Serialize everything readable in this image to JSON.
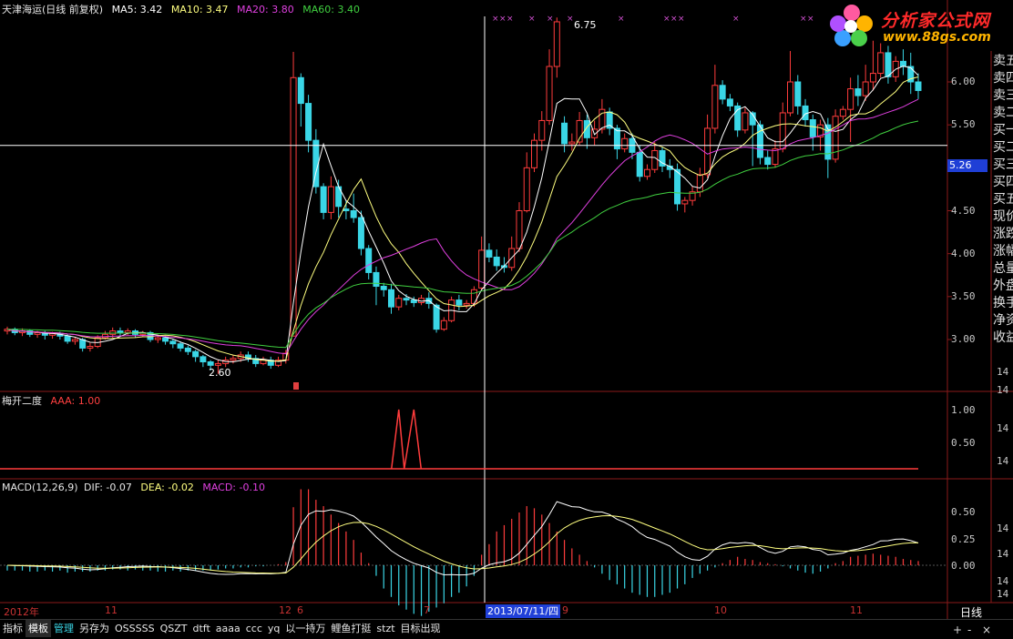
{
  "header_main": {
    "title": "天津海运(日线 前复权)",
    "ma5": "MA5: 3.42",
    "ma10": "MA10: 3.47",
    "ma20": "MA20: 3.80",
    "ma60": "MA60: 3.40"
  },
  "header_ind": {
    "title": "梅开二度",
    "aaa": "AAA: 1.00"
  },
  "header_macd": {
    "title": "MACD(12,26,9)",
    "dif": "DIF: -0.07",
    "dea": "DEA: -0.02",
    "macd": "MACD: -0.10"
  },
  "colors": {
    "up": "#ff3c3c",
    "down": "#3ad6e6",
    "ma5": "#ffffff",
    "ma10": "#ffff80",
    "ma20": "#e040e0",
    "ma60": "#40d040",
    "grid": "#8b1a1a"
  },
  "price_axis": [
    "6.00",
    "5.50",
    "5.00",
    "4.50",
    "4.00",
    "3.50",
    "3.00"
  ],
  "price_axis_cut": [
    "14",
    "14"
  ],
  "ind_axis": [
    "1.00",
    "14",
    "0.50",
    "14"
  ],
  "macd_axis": [
    "0.50",
    "14",
    "0.25",
    "14",
    "0.00",
    "14",
    "14",
    "15"
  ],
  "current_price": "5.26",
  "annotations": {
    "high": "6.75",
    "low": "2.60"
  },
  "dates": {
    "year": "2012年",
    "m11": "11",
    "m12": "12",
    "m6": "6",
    "m7": "7",
    "m9": "9",
    "m10": "10",
    "m11b": "11",
    "selected": "2013/07/11/四"
  },
  "period": "日线",
  "sidebar": [
    "卖五",
    "卖四",
    "卖三",
    "卖二",
    "买一",
    "买二",
    "买三",
    "买四",
    "买五",
    "现价",
    "涨跌",
    "涨幅",
    "总量",
    "外盘",
    "换手",
    "净资",
    "收益"
  ],
  "toolbar": [
    "指标",
    "模板",
    "管理",
    "另存为",
    "OSSSSS",
    "QSZT",
    "dtft",
    "aaaa",
    "ccc",
    "yq",
    "以一持万",
    "鲤鱼打挺",
    "stzt",
    "目标出现"
  ],
  "zoom": {
    "plus": "+",
    "minus": "-",
    "close": "×"
  },
  "logo": {
    "text": "分析家公式网",
    "url": "www.88gs.com"
  },
  "chart_data": {
    "type": "candlestick",
    "price_range": [
      2.5,
      6.8
    ],
    "macd_range": [
      -0.75,
      0.85
    ],
    "candles": [
      [
        3.1,
        3.12,
        3.06,
        3.15
      ],
      [
        3.12,
        3.08,
        3.05,
        3.14
      ],
      [
        3.08,
        3.1,
        3.04,
        3.13
      ],
      [
        3.1,
        3.06,
        3.03,
        3.12
      ],
      [
        3.06,
        3.08,
        3.02,
        3.1
      ],
      [
        3.08,
        3.05,
        3.0,
        3.1
      ],
      [
        3.05,
        3.07,
        3.01,
        3.09
      ],
      [
        3.07,
        3.04,
        3.0,
        3.09
      ],
      [
        3.04,
        2.98,
        2.95,
        3.06
      ],
      [
        2.98,
        3.0,
        2.94,
        3.03
      ],
      [
        3.0,
        2.9,
        2.86,
        3.02
      ],
      [
        2.9,
        2.92,
        2.86,
        2.96
      ],
      [
        2.92,
        3.02,
        2.9,
        3.05
      ],
      [
        3.02,
        3.06,
        3.0,
        3.1
      ],
      [
        3.06,
        3.1,
        3.02,
        3.14
      ],
      [
        3.1,
        3.08,
        3.04,
        3.14
      ],
      [
        3.08,
        3.1,
        3.05,
        3.13
      ],
      [
        3.1,
        3.06,
        3.02,
        3.12
      ],
      [
        3.06,
        3.08,
        3.03,
        3.1
      ],
      [
        3.08,
        3.0,
        2.97,
        3.1
      ],
      [
        3.0,
        3.02,
        2.96,
        3.05
      ],
      [
        3.02,
        2.98,
        2.94,
        3.04
      ],
      [
        2.98,
        2.95,
        2.9,
        3.0
      ],
      [
        2.95,
        2.9,
        2.86,
        2.98
      ],
      [
        2.9,
        2.86,
        2.82,
        2.93
      ],
      [
        2.86,
        2.8,
        2.74,
        2.88
      ],
      [
        2.8,
        2.74,
        2.68,
        2.82
      ],
      [
        2.74,
        2.7,
        2.64,
        2.76
      ],
      [
        2.7,
        2.72,
        2.6,
        2.76
      ],
      [
        2.72,
        2.76,
        2.68,
        2.8
      ],
      [
        2.76,
        2.78,
        2.72,
        2.82
      ],
      [
        2.78,
        2.82,
        2.74,
        2.86
      ],
      [
        2.82,
        2.78,
        2.74,
        2.86
      ],
      [
        2.78,
        2.72,
        2.68,
        2.82
      ],
      [
        2.72,
        2.76,
        2.7,
        2.8
      ],
      [
        2.76,
        2.7,
        2.66,
        2.8
      ],
      [
        2.7,
        2.76,
        2.68,
        2.8
      ],
      [
        2.76,
        2.84,
        2.72,
        2.88
      ],
      [
        3.04,
        6.05,
        3.04,
        6.35
      ],
      [
        6.05,
        5.75,
        5.48,
        6.1
      ],
      [
        5.75,
        5.32,
        5.18,
        5.85
      ],
      [
        5.32,
        4.78,
        4.7,
        5.45
      ],
      [
        4.78,
        4.48,
        4.4,
        4.82
      ],
      [
        4.48,
        4.78,
        4.4,
        4.9
      ],
      [
        4.78,
        4.55,
        4.42,
        4.86
      ],
      [
        4.52,
        4.5,
        4.4,
        4.62
      ],
      [
        4.5,
        4.42,
        4.36,
        4.7
      ],
      [
        4.42,
        4.06,
        3.98,
        4.5
      ],
      [
        4.06,
        3.78,
        3.7,
        4.1
      ],
      [
        3.78,
        3.62,
        3.4,
        3.85
      ],
      [
        3.62,
        3.58,
        3.5,
        3.66
      ],
      [
        3.58,
        3.38,
        3.3,
        3.65
      ],
      [
        3.38,
        3.48,
        3.34,
        3.52
      ],
      [
        3.48,
        3.46,
        3.4,
        3.53
      ],
      [
        3.46,
        3.43,
        3.38,
        3.5
      ],
      [
        3.43,
        3.48,
        3.4,
        3.52
      ],
      [
        3.48,
        3.42,
        3.36,
        3.55
      ],
      [
        3.4,
        3.12,
        3.08,
        3.42
      ],
      [
        3.12,
        3.22,
        3.1,
        3.26
      ],
      [
        3.22,
        3.46,
        3.2,
        3.5
      ],
      [
        3.46,
        3.4,
        3.34,
        3.52
      ],
      [
        3.4,
        3.42,
        3.36,
        3.46
      ],
      [
        3.42,
        3.58,
        3.38,
        3.62
      ],
      [
        3.6,
        4.04,
        3.58,
        4.2
      ],
      [
        4.04,
        3.96,
        3.9,
        4.12
      ],
      [
        3.96,
        3.86,
        3.8,
        4.05
      ],
      [
        3.86,
        3.84,
        3.78,
        3.96
      ],
      [
        3.84,
        4.06,
        3.8,
        4.2
      ],
      [
        4.06,
        4.5,
        4.02,
        4.6
      ],
      [
        4.5,
        5.0,
        4.48,
        5.18
      ],
      [
        5.0,
        5.32,
        4.95,
        5.4
      ],
      [
        5.32,
        5.55,
        5.2,
        5.66
      ],
      [
        5.55,
        6.18,
        5.5,
        6.38
      ],
      [
        6.18,
        6.7,
        6.05,
        6.75
      ],
      [
        5.52,
        5.28,
        5.18,
        5.6
      ],
      [
        5.28,
        5.3,
        5.2,
        5.4
      ],
      [
        5.3,
        5.55,
        5.26,
        5.65
      ],
      [
        5.55,
        5.35,
        5.22,
        5.62
      ],
      [
        5.35,
        5.45,
        5.26,
        5.55
      ],
      [
        5.45,
        5.68,
        5.4,
        5.8
      ],
      [
        5.65,
        5.46,
        5.38,
        5.7
      ],
      [
        5.46,
        5.22,
        5.1,
        5.5
      ],
      [
        5.22,
        5.34,
        5.18,
        5.4
      ],
      [
        5.34,
        5.18,
        5.1,
        5.4
      ],
      [
        5.18,
        4.9,
        4.84,
        5.26
      ],
      [
        4.9,
        4.98,
        4.86,
        5.04
      ],
      [
        4.98,
        5.2,
        4.94,
        5.3
      ],
      [
        5.2,
        5.02,
        4.95,
        5.24
      ],
      [
        5.02,
        4.98,
        4.88,
        5.1
      ],
      [
        4.98,
        4.58,
        4.5,
        5.05
      ],
      [
        4.58,
        4.62,
        4.48,
        4.66
      ],
      [
        4.62,
        4.72,
        4.56,
        4.78
      ],
      [
        4.72,
        4.92,
        4.66,
        5.0
      ],
      [
        4.92,
        5.46,
        4.88,
        5.62
      ],
      [
        5.46,
        5.96,
        5.4,
        6.2
      ],
      [
        5.96,
        5.8,
        5.74,
        6.02
      ],
      [
        5.8,
        5.72,
        5.66,
        5.86
      ],
      [
        5.72,
        5.44,
        5.36,
        5.76
      ],
      [
        5.44,
        5.64,
        5.4,
        5.7
      ],
      [
        5.64,
        5.5,
        5.02,
        5.66
      ],
      [
        5.5,
        5.12,
        5.04,
        5.55
      ],
      [
        5.12,
        5.04,
        4.98,
        5.2
      ],
      [
        5.04,
        5.22,
        5.0,
        5.32
      ],
      [
        5.22,
        5.64,
        5.18,
        5.76
      ],
      [
        5.64,
        6.0,
        5.6,
        6.36
      ],
      [
        6.0,
        5.72,
        5.62,
        6.08
      ],
      [
        5.72,
        5.56,
        5.48,
        5.8
      ],
      [
        5.56,
        5.36,
        5.2,
        5.62
      ],
      [
        5.36,
        5.5,
        5.2,
        5.56
      ],
      [
        5.5,
        5.1,
        4.88,
        5.58
      ],
      [
        5.1,
        5.6,
        5.06,
        5.68
      ],
      [
        5.6,
        5.68,
        5.56,
        5.72
      ],
      [
        5.68,
        5.92,
        5.3,
        6.05
      ],
      [
        5.92,
        5.84,
        5.72,
        6.08
      ],
      [
        5.84,
        6.0,
        5.78,
        6.2
      ],
      [
        6.0,
        6.1,
        5.9,
        6.48
      ],
      [
        6.1,
        6.34,
        6.05,
        6.45
      ],
      [
        6.34,
        6.06,
        5.98,
        6.42
      ],
      [
        6.06,
        6.24,
        6.0,
        6.3
      ],
      [
        6.24,
        6.18,
        6.08,
        6.38
      ],
      [
        6.18,
        6.0,
        5.86,
        6.34
      ],
      [
        6.0,
        5.9,
        5.8,
        6.1
      ]
    ],
    "macd_hist": [
      -0.05,
      -0.05,
      -0.05,
      -0.06,
      -0.06,
      -0.05,
      -0.06,
      -0.05,
      -0.07,
      -0.06,
      -0.06,
      -0.06,
      -0.05,
      -0.05,
      -0.04,
      -0.04,
      -0.05,
      -0.04,
      -0.05,
      -0.05,
      -0.06,
      -0.06,
      -0.05,
      -0.06,
      -0.05,
      -0.05,
      -0.05,
      -0.05,
      -0.04,
      -0.03,
      -0.03,
      -0.02,
      -0.02,
      -0.01,
      -0.01,
      0.0,
      0.01,
      0.03,
      0.55,
      0.72,
      0.72,
      0.62,
      0.56,
      0.48,
      0.4,
      0.32,
      0.24,
      0.12,
      0.02,
      -0.1,
      -0.22,
      -0.3,
      -0.38,
      -0.42,
      -0.46,
      -0.48,
      -0.44,
      -0.4,
      -0.36,
      -0.3,
      -0.26,
      -0.2,
      -0.1,
      0.1,
      0.2,
      0.32,
      0.38,
      0.44,
      0.5,
      0.56,
      0.54,
      0.48,
      0.4,
      0.32,
      0.24,
      0.16,
      0.1,
      0.04,
      -0.02,
      -0.08,
      -0.14,
      -0.18,
      -0.22,
      -0.26,
      -0.28,
      -0.3,
      -0.3,
      -0.28,
      -0.26,
      -0.22,
      -0.18,
      -0.12,
      -0.08,
      -0.05,
      -0.02,
      0.02,
      0.05,
      0.08,
      0.06,
      0.05,
      0.03,
      0.02,
      0.01,
      -0.01,
      -0.03,
      -0.05,
      -0.07,
      -0.08,
      -0.06,
      -0.03,
      0.02,
      0.04,
      0.08,
      0.09,
      0.1,
      0.11,
      0.1,
      0.09,
      0.08,
      0.06,
      0.05,
      0.04,
      0.03
    ],
    "ind_signals": [
      52,
      54
    ]
  }
}
